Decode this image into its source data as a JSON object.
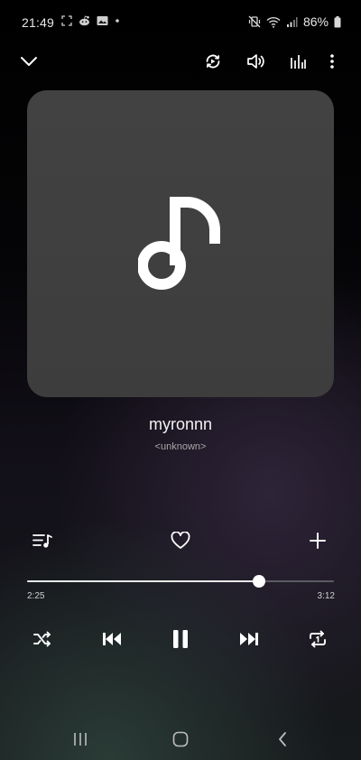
{
  "status_bar": {
    "time": "21:49",
    "battery": "86%"
  },
  "player": {
    "title": "myronnn",
    "artist": "<unknown>",
    "elapsed": "2:25",
    "duration": "3:12",
    "progress_fraction": 0.755,
    "state": "playing"
  },
  "icons": {
    "collapse": "chevron-down-icon",
    "smart_view": "cast-icon",
    "volume": "volume-icon",
    "equalizer": "equalizer-icon",
    "more": "more-vertical-icon",
    "album_placeholder": "music-note-icon",
    "queue": "playlist-icon",
    "favorite": "heart-icon",
    "add": "add-icon",
    "shuffle": "shuffle-icon",
    "previous": "skip-previous-icon",
    "pause": "pause-icon",
    "next": "skip-next-icon",
    "repeat": "repeat-one-icon",
    "recents": "recents-icon",
    "home": "home-icon",
    "back": "back-icon"
  },
  "colors": {
    "accent": "#ffffff",
    "art_background": "#404040",
    "track_inactive": "#5b5b5f"
  }
}
